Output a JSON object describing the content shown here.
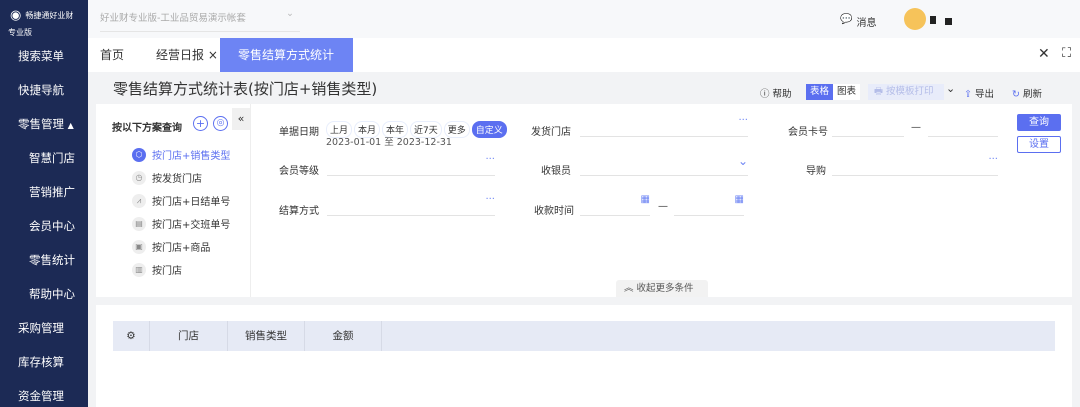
{
  "brand": {
    "name": "畅捷通好业财",
    "edition": "专业版"
  },
  "topbar": {
    "account": "好业财专业版-工业品贸易演示帐套",
    "messages": "消息"
  },
  "sidebar": {
    "items": [
      {
        "label": "搜索菜单",
        "level": "top"
      },
      {
        "label": "快捷导航",
        "level": "top"
      },
      {
        "label": "零售管理",
        "level": "top",
        "expanded": true
      },
      {
        "label": "智慧门店",
        "level": "sub"
      },
      {
        "label": "营销推广",
        "level": "sub"
      },
      {
        "label": "会员中心",
        "level": "sub"
      },
      {
        "label": "零售统计",
        "level": "sub"
      },
      {
        "label": "帮助中心",
        "level": "sub"
      },
      {
        "label": "采购管理",
        "level": "top"
      },
      {
        "label": "库存核算",
        "level": "top"
      },
      {
        "label": "资金管理",
        "level": "top"
      }
    ]
  },
  "tabs": [
    {
      "label": "首页"
    },
    {
      "label": "经营日报",
      "closable": true
    },
    {
      "label": "零售结算方式统计表",
      "closable": true,
      "active": true
    }
  ],
  "page": {
    "title": "零售结算方式统计表(按门店+销售类型)"
  },
  "toolbar": {
    "help": "帮助",
    "table": "表格",
    "chart": "图表",
    "print": "按模板打印",
    "export": "导出",
    "refresh": "刷新"
  },
  "schemes": {
    "title": "按以下方案查询",
    "items": [
      {
        "label": "按门店+销售类型",
        "active": true
      },
      {
        "label": "按发货门店"
      },
      {
        "label": "按门店+日结单号"
      },
      {
        "label": "按门店+交班单号"
      },
      {
        "label": "按门店+商品"
      },
      {
        "label": "按门店"
      }
    ]
  },
  "filters": {
    "date": {
      "label": "单据日期",
      "chips": [
        "上月",
        "本月",
        "本年",
        "近7天",
        "更多",
        "自定义"
      ],
      "active": "自定义",
      "range": "2023-01-01 至 2023-12-31"
    },
    "member_level": {
      "label": "会员等级",
      "value": ""
    },
    "settle": {
      "label": "结算方式",
      "value": ""
    },
    "ship_store": {
      "label": "发货门店",
      "value": ""
    },
    "cashier": {
      "label": "收银员",
      "value": ""
    },
    "pay_time": {
      "label": "收款时间",
      "sep": "—"
    },
    "card": {
      "label": "会员卡号",
      "sep": "—"
    },
    "guide": {
      "label": "导购",
      "value": ""
    },
    "query": "查询",
    "settings": "设置",
    "collapse": "收起更多条件"
  },
  "table": {
    "columns": [
      "门店",
      "销售类型",
      "金额"
    ]
  },
  "colors": {
    "sidebar": "#1c2a55",
    "accent": "#5b6ff0",
    "active_tab": "#6d84f4"
  }
}
